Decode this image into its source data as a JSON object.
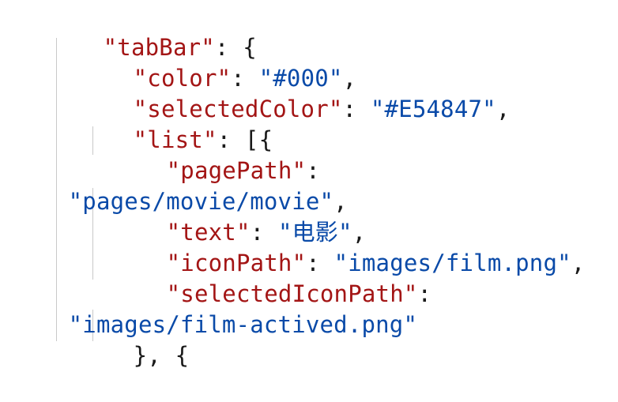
{
  "code": {
    "language": "json",
    "colors": {
      "key": "#a31515",
      "value": "#0a4aa8",
      "punctuation": "#1a1a1a",
      "indent_guide": "#c9c9c9"
    },
    "lines": [
      {
        "key": "\"tabBar\"",
        "tail": ": {"
      },
      {
        "key": "\"color\"",
        "mid": ": ",
        "value": "\"#000\"",
        "tail": ","
      },
      {
        "key": "\"selectedColor\"",
        "mid": ": ",
        "value": "\"#E54847\"",
        "tail": ","
      },
      {
        "key": "\"list\"",
        "tail": ": [{"
      },
      {
        "key": "\"pagePath\"",
        "tail": ":"
      },
      {
        "value": "\"pages/movie/movie\"",
        "tail": ","
      },
      {
        "key": "\"text\"",
        "mid": ": ",
        "value": "\"电影\"",
        "tail": ","
      },
      {
        "key": "\"iconPath\"",
        "mid": ": ",
        "value": "\"images/film.png\"",
        "tail": ","
      },
      {
        "key": "\"selectedIconPath\"",
        "tail": ":"
      },
      {
        "value": "\"images/film-actived.png\""
      },
      {
        "tail": "}, {"
      }
    ]
  }
}
